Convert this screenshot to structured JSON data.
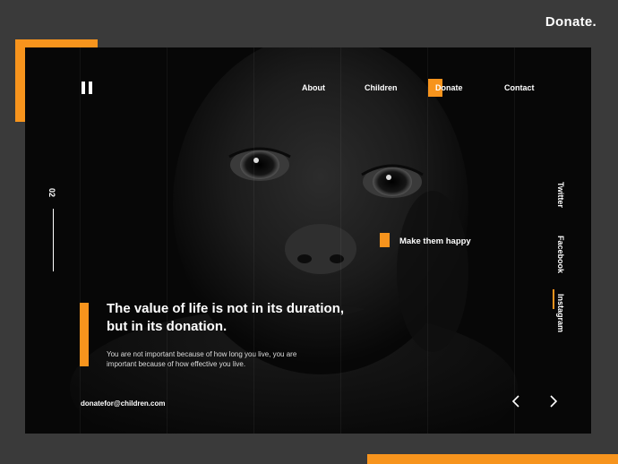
{
  "brand": {
    "title": "Donate."
  },
  "nav": {
    "items": [
      "About",
      "Children",
      "Donate",
      "Contact"
    ],
    "active": "Donate"
  },
  "slide": {
    "number": "02"
  },
  "social": {
    "links": [
      "Twitter",
      "Facebook",
      "Instagram"
    ],
    "active": "Instagram"
  },
  "hero": {
    "tag": "Make them happy",
    "headline_line1": "The value of life is not in its duration,",
    "headline_line2": "but in its donation.",
    "subtext_line1": "You are not important because of how long you live, you are",
    "subtext_line2": "important because of how effective you live."
  },
  "footer": {
    "email": "donatefor@children.com"
  },
  "icons": {
    "prev": "chevron-left-icon",
    "next": "chevron-right-icon",
    "logo": "pause-bars-icon"
  },
  "colors": {
    "accent": "#f7941d",
    "background": "#3a3a3a",
    "card": "#070707",
    "text": "#ffffff"
  }
}
